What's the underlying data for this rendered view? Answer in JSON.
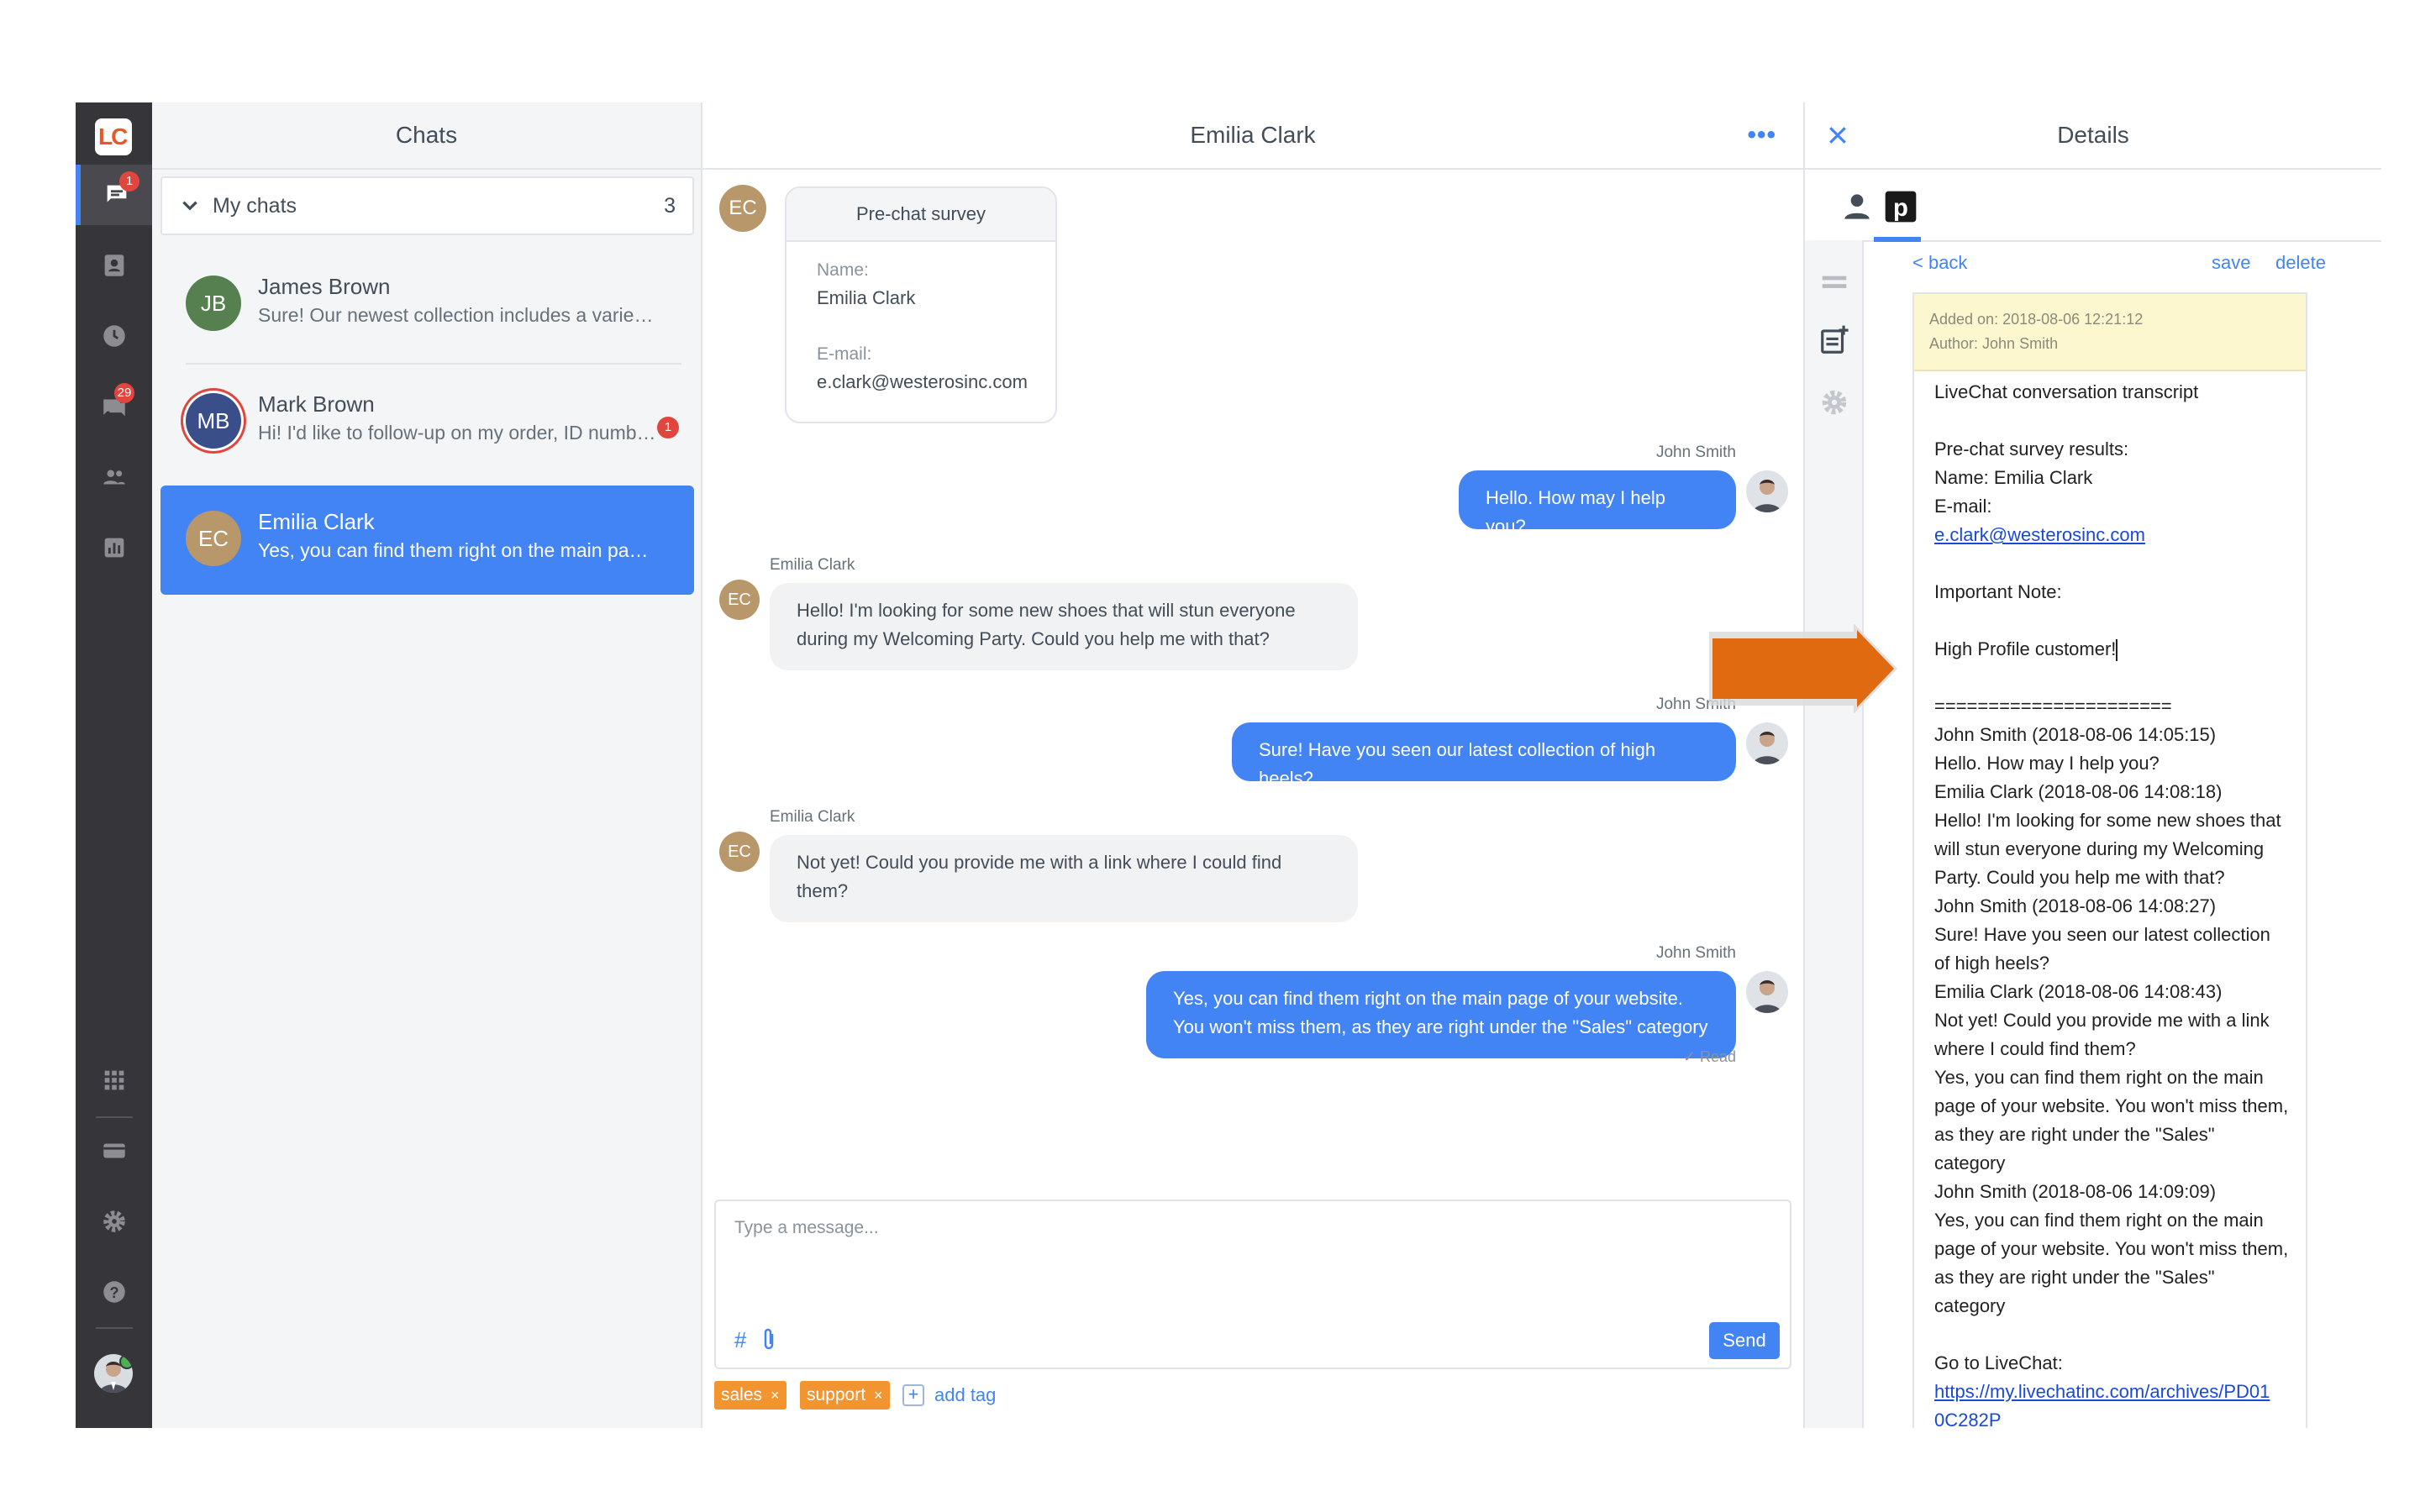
{
  "rail": {
    "logo": "LC",
    "badges": {
      "chats": "1",
      "archives": "29"
    }
  },
  "chats_panel": {
    "title": "Chats",
    "group": {
      "label": "My chats",
      "count": "3"
    },
    "items": [
      {
        "initials": "JB",
        "name": "James Brown",
        "preview": "Sure! Our newest collection includes a variety ...",
        "color": "#56804f"
      },
      {
        "initials": "MB",
        "name": "Mark Brown",
        "preview": "Hi! I'd like to follow-up on my order, ID numbe...",
        "color": "#3a4f8a",
        "unread": "1"
      },
      {
        "initials": "EC",
        "name": "Emilia Clark",
        "preview": "Yes, you can find them right on the main page ...",
        "color": "#b8976a"
      }
    ]
  },
  "conversation": {
    "title": "Emilia Clark",
    "customer_initials": "EC",
    "survey": {
      "title": "Pre-chat survey",
      "name_label": "Name:",
      "name_value": "Emilia Clark",
      "email_label": "E-mail:",
      "email_value": "e.clark@westerosinc.com"
    },
    "messages": [
      {
        "sender": "John Smith",
        "text": "Hello. How may I help you?"
      },
      {
        "sender": "Emilia Clark",
        "text": "Hello! I'm looking for some new shoes that will stun everyone during my Welcoming Party. Could you help me with that?"
      },
      {
        "sender": "John Smith",
        "text": "Sure! Have you seen our latest collection of high heels?"
      },
      {
        "sender": "Emilia Clark",
        "text": "Not yet! Could you provide me with a link where I could find them?"
      },
      {
        "sender": "John Smith",
        "text": "Yes, you can find them right on the main page of your website. You won't miss them, as they are right under the \"Sales\" category"
      }
    ],
    "read_label": "✓ Read",
    "composer": {
      "placeholder": "Type a message...",
      "send_label": "Send"
    },
    "tags": [
      "sales",
      "support"
    ],
    "add_tag_label": "add tag"
  },
  "details": {
    "title": "Details",
    "back_label": "< back",
    "save_label": "save",
    "delete_label": "delete",
    "note": {
      "added_on": "Added on: 2018-08-06 12:21:12",
      "author": "Author: John Smith",
      "lines": [
        "LiveChat conversation transcript",
        "",
        "Pre-chat survey results:",
        "Name: Emilia Clark",
        "E-mail:",
        "e.clark@westerosinc.com",
        "",
        "Important Note:",
        "",
        "High Profile customer!",
        "",
        "======================",
        "John Smith (2018-08-06 14:05:15)",
        "Hello. How may I help you?",
        "Emilia Clark (2018-08-06 14:08:18)",
        "Hello! I'm looking for some new shoes that",
        "will stun everyone during my Welcoming",
        "Party. Could you help me with that?",
        "John Smith (2018-08-06 14:08:27)",
        "Sure! Have you seen our latest collection",
        "of high heels?",
        "Emilia Clark (2018-08-06 14:08:43)",
        "Not yet! Could you provide me with a link",
        "where I could find them?",
        "Yes, you can find them right on the main",
        "page of your website. You won't miss them,",
        "as they are right under the \"Sales\"",
        "category",
        "John Smith (2018-08-06 14:09:09)",
        "Yes, you can find them right on the main",
        "page of your website. You won't miss them,",
        "as they are right under the \"Sales\"",
        "category",
        "",
        "Go to LiveChat:",
        "https://my.livechatinc.com/archives/PD01",
        "0C282P"
      ]
    }
  },
  "colors": {
    "accent": "#4384f5",
    "rail": "#36353a",
    "tag": "#f29430",
    "highlight_arrow": "#e06a10"
  },
  "icons": [
    "chats-icon",
    "contacts-icon",
    "history-icon",
    "archives-icon",
    "team-icon",
    "reports-icon",
    "apps-icon",
    "billing-icon",
    "settings-icon",
    "help-icon",
    "close-icon",
    "user-icon",
    "pipedrive-icon",
    "hamburger-icon",
    "add-note-icon",
    "gear-icon",
    "hash-icon",
    "paperclip-icon"
  ]
}
